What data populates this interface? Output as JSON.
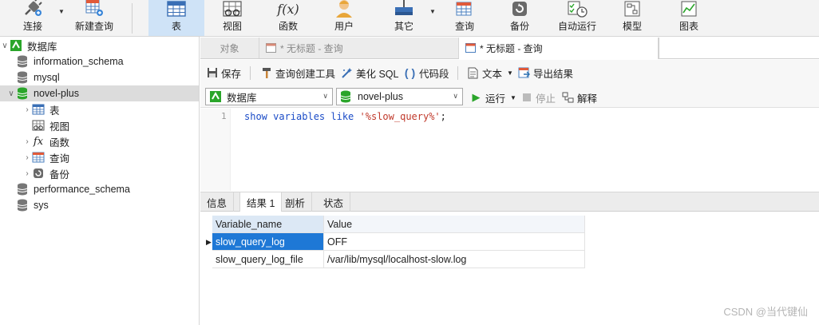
{
  "toolbar": {
    "connect": "连接",
    "new_query": "新建查询",
    "table": "表",
    "view": "视图",
    "function": "函数",
    "user": "用户",
    "other": "其它",
    "query": "查询",
    "backup": "备份",
    "auto_run": "自动运行",
    "model": "模型",
    "chart": "图表",
    "function_icon_glyph": "f(x)"
  },
  "sidebar": {
    "items": [
      {
        "label": "数据库"
      },
      {
        "label": "information_schema"
      },
      {
        "label": "mysql"
      },
      {
        "label": "novel-plus"
      },
      {
        "label": "表"
      },
      {
        "label": "视图"
      },
      {
        "label": "函数"
      },
      {
        "label": "查询"
      },
      {
        "label": "备份"
      },
      {
        "label": "performance_schema"
      },
      {
        "label": "sys"
      }
    ],
    "fx_glyph": "fx"
  },
  "tabs": [
    {
      "label": "对象"
    },
    {
      "label": "* 无标题 - 查询"
    },
    {
      "label": "* 无标题 - 查询"
    }
  ],
  "query_toolbar": {
    "save": "保存",
    "query_builder": "查询创建工具",
    "beautify": "美化 SQL",
    "snippet": "代码段",
    "text": "文本",
    "export": "导出结果"
  },
  "selectors": {
    "connection": "数据库",
    "database": "novel-plus",
    "run": "运行",
    "stop": "停止",
    "explain": "解释"
  },
  "editor": {
    "line_number": "1",
    "kw1": "show variables like",
    "str": "'%slow_query%'",
    "end": ";"
  },
  "result_tabs": [
    {
      "label": "信息"
    },
    {
      "label": "结果 1"
    },
    {
      "label": "剖析"
    },
    {
      "label": "状态"
    }
  ],
  "results": {
    "columns": [
      "Variable_name",
      "Value"
    ],
    "rows": [
      [
        "slow_query_log",
        "OFF"
      ],
      [
        "slow_query_log_file",
        "/var/lib/mysql/localhost-slow.log"
      ]
    ]
  },
  "watermark": "CSDN @当代键仙",
  "colors": {
    "accent": "#1e78d6",
    "run_green": "#2aa52a",
    "db_green": "#2aa52a"
  }
}
